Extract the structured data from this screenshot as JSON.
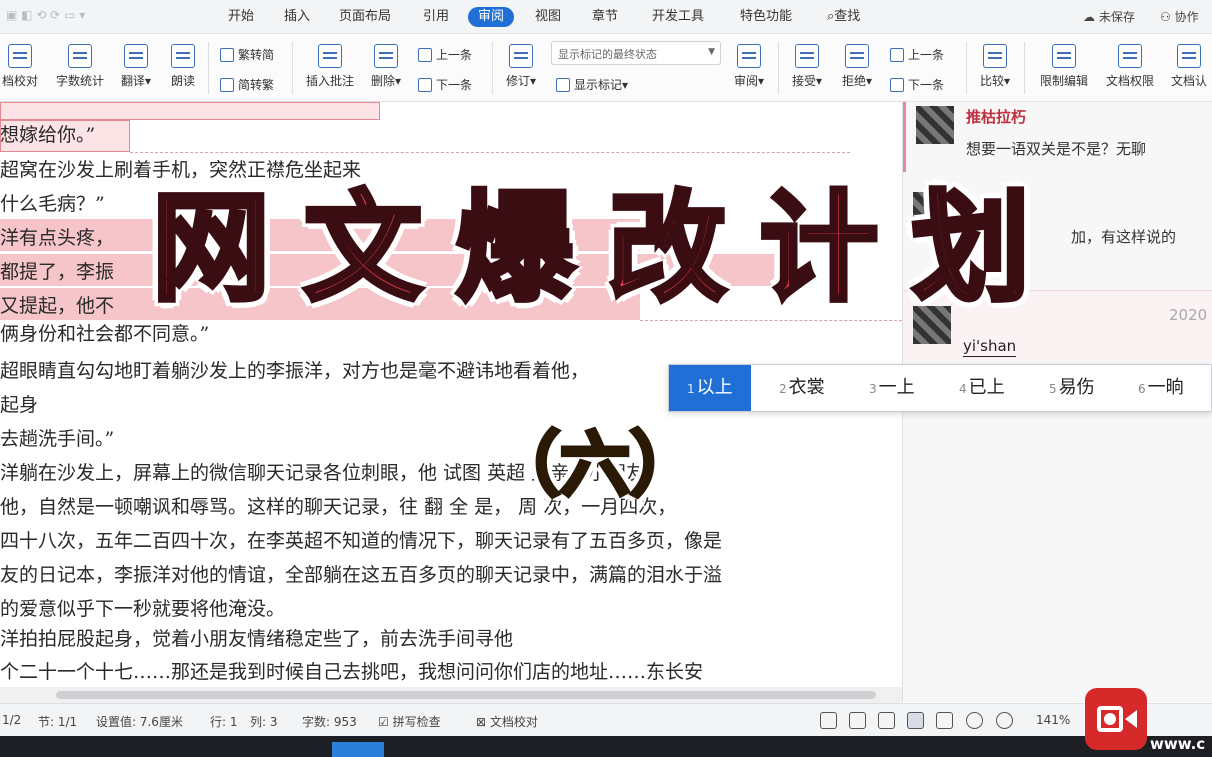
{
  "menubar": {
    "tabs": [
      "开始",
      "插入",
      "页面布局",
      "引用",
      "审阅",
      "视图",
      "章节",
      "开发工具",
      "特色功能"
    ],
    "active_tab": "审阅",
    "search": "查找",
    "unsaved": "未保存",
    "collab": "协作"
  },
  "ribbon": {
    "doc_check": "档校对",
    "word_count": "字数统计",
    "translate": "翻译",
    "read_aloud": "朗读",
    "trad_to_simp": "繁转简",
    "simp_to_trad": "简转繁",
    "insert_comment": "插入批注",
    "delete": "删除",
    "prev_1": "上一条",
    "next_1": "下一条",
    "track_changes": "修订",
    "markup_select": "显示标记的最终状态",
    "show_markup": "显示标记",
    "review": "审阅",
    "accept": "接受",
    "reject": "拒绝",
    "prev_2": "上一条",
    "next_2": "下一条",
    "compare": "比较",
    "restrict_edit": "限制编辑",
    "doc_permission": "文档权限",
    "doc_verify": "文档认"
  },
  "document": {
    "lines": [
      "想嫁给你。”",
      "超窝在沙发上刷着手机，突然正襟危坐起来",
      "什么毛病？”",
      "洋有点头疼，",
      "都提了，李振",
      "又提起，他不",
      "俩身份和社会都不同意。”",
      "超眼睛直勾勾地盯着躺沙发上的李振洋，对方也是毫不避讳地看着他，",
      "起身",
      "去趟洗手间。”",
      "洋躺在沙发上，屏幕上的微信聊天记录各位刺眼，他 试图 英超 父亲把小朋友",
      "他，自然是一顿嘲讽和辱骂。这样的聊天记录，往 翻 全 是， 周 次，一月四次，",
      "四十八次，五年二百四十次，在李英超不知道的情况下，聊天记录有了五百多页，像是",
      "友的日记本，李振洋对他的情谊，全部躺在这五百多页的聊天记录中，满篇的泪水于溢",
      "的爱意似乎下一秒就要将他淹没。",
      "洋拍拍屁股起身，觉着小朋友情绪稳定些了，前去洗手间寻他",
      "个二十一个十七……那还是我到时候自己去挑吧，我想问问你们店的地址……东长安"
    ]
  },
  "comments": [
    {
      "author": "推枯拉朽",
      "text": "想要一语双关是不是？无聊"
    },
    {
      "author": "",
      "text": "加，有这样说的"
    },
    {
      "author": "",
      "date": "2020",
      "input": "yi'shan"
    }
  ],
  "ime": {
    "candidates": [
      {
        "n": "1",
        "word": "以上"
      },
      {
        "n": "2",
        "word": "衣裳"
      },
      {
        "n": "3",
        "word": "一上"
      },
      {
        "n": "4",
        "word": "已上"
      },
      {
        "n": "5",
        "word": "易伤"
      },
      {
        "n": "6",
        "word": "一晌"
      }
    ]
  },
  "status": {
    "page": "1/2",
    "section": "节: 1/1",
    "setting": "设置值: 7.6厘米",
    "row": "行: 1",
    "col": "列: 3",
    "words": "字数: 953",
    "spell": "拼写检查",
    "proof": "文档校对",
    "zoom": "141%"
  },
  "overlay": {
    "title": "网文爆改计划",
    "subtitle": "（六）"
  },
  "watermark": "www.c",
  "colors": {
    "accent": "#1f6fd6",
    "title_red": "#e23a4e",
    "subtitle_yellow": "#f5c423",
    "highlight_pink": "#f5c5ca",
    "recorder_red": "#d62a2a"
  }
}
